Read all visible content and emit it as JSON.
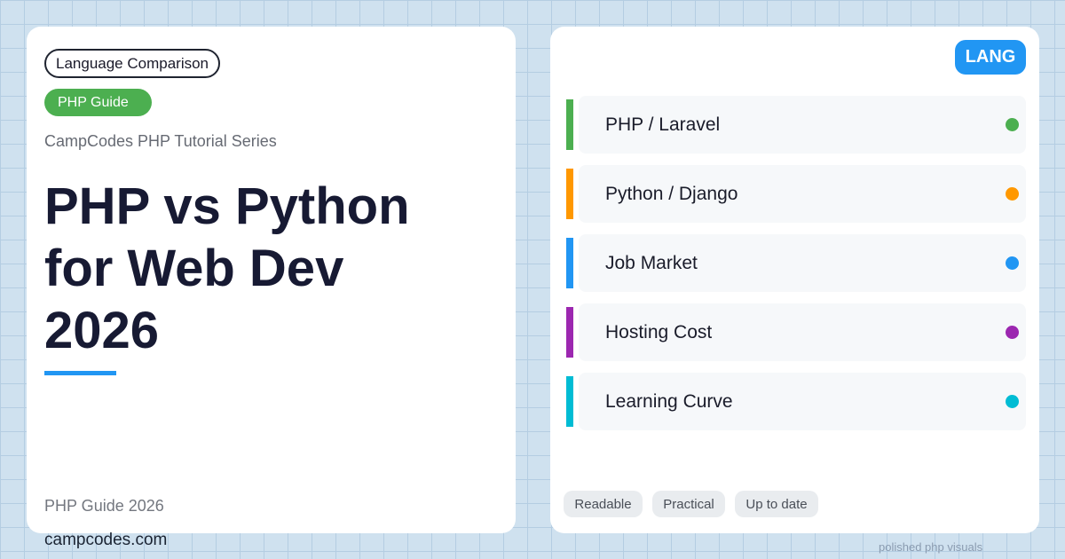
{
  "left": {
    "category_pill": "Language Comparison",
    "guide_pill": "PHP Guide",
    "series": "CampCodes PHP Tutorial Series",
    "title_lines": [
      "PHP vs Python",
      "for Web Dev",
      "2026"
    ],
    "footer_label": "PHP Guide 2026"
  },
  "site": "campcodes.com",
  "footer_note": "polished php visuals",
  "right": {
    "badge": "LANG",
    "topics": [
      {
        "label": "PHP / Laravel",
        "color": "#4caf50"
      },
      {
        "label": "Python / Django",
        "color": "#ff9800"
      },
      {
        "label": "Job Market",
        "color": "#2196f3"
      },
      {
        "label": "Hosting Cost",
        "color": "#9c27b0"
      },
      {
        "label": "Learning Curve",
        "color": "#00bcd4"
      }
    ],
    "tags": [
      "Readable",
      "Practical",
      "Up to date"
    ]
  },
  "colors": {
    "accent_blue": "#2196f3",
    "accent_green": "#4caf50",
    "title_color": "#171a33"
  }
}
